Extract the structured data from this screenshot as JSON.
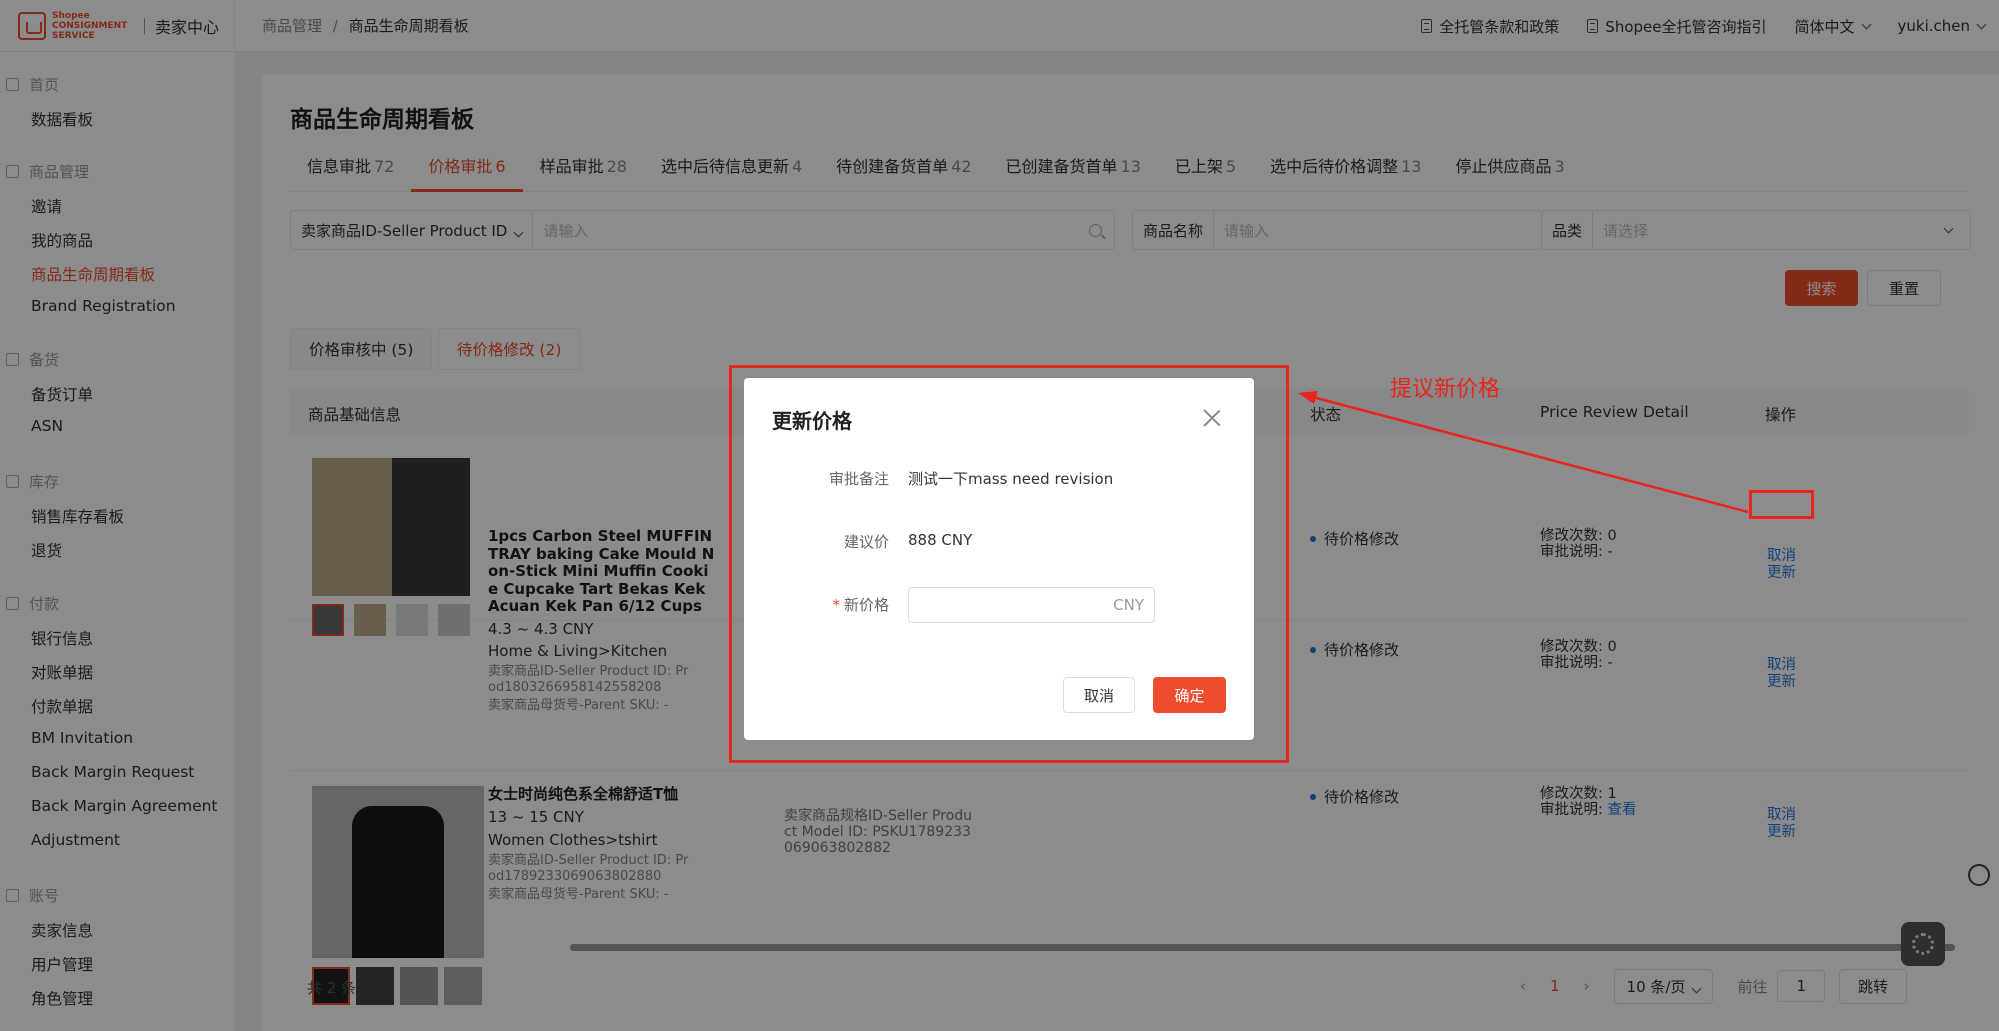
{
  "header": {
    "logo_text": "Shopee CONSIGNMENT SERVICE",
    "center_title": "卖家中心",
    "breadcrumb_parent": "商品管理",
    "breadcrumb_sep": "/",
    "breadcrumb_current": "商品生命周期看板",
    "links": [
      "全托管条款和政策",
      "Shopee全托管咨询指引"
    ],
    "language": "简体中文",
    "user": "yuki.chen"
  },
  "sidebar": {
    "groups": [
      {
        "label": "首页",
        "items": [
          "数据看板"
        ]
      },
      {
        "label": "商品管理",
        "items": [
          "邀请",
          "我的商品",
          "商品生命周期看板",
          "Brand Registration"
        ]
      },
      {
        "label": "备货",
        "items": [
          "备货订单",
          "ASN"
        ]
      },
      {
        "label": "库存",
        "items": [
          "销售库存看板",
          "退货"
        ]
      },
      {
        "label": "付款",
        "items": [
          "银行信息",
          "对账单据",
          "付款单据",
          "BM Invitation",
          "Back Margin Request",
          "Back Margin Agreement",
          "Adjustment"
        ]
      },
      {
        "label": "账号",
        "items": [
          "卖家信息",
          "用户管理",
          "角色管理"
        ]
      }
    ],
    "active_item": "商品生命周期看板"
  },
  "page": {
    "title": "商品生命周期看板",
    "tabs": [
      {
        "label": "信息审批",
        "count": "72"
      },
      {
        "label": "价格审批",
        "count": "6"
      },
      {
        "label": "样品审批",
        "count": "28"
      },
      {
        "label": "选中后待信息更新",
        "count": "4"
      },
      {
        "label": "待创建备货首单",
        "count": "42"
      },
      {
        "label": "已创建备货首单",
        "count": "13"
      },
      {
        "label": "已上架",
        "count": "5"
      },
      {
        "label": "选中后待价格调整",
        "count": "13"
      },
      {
        "label": "停止供应商品",
        "count": "3"
      }
    ],
    "active_tab": "价格审批"
  },
  "filters": {
    "id_select": "卖家商品ID-Seller Product ID",
    "id_placeholder": "请输入",
    "name_label": "商品名称",
    "name_placeholder": "请输入",
    "category_label": "品类",
    "category_placeholder": "请选择",
    "search_button": "搜索",
    "reset_button": "重置"
  },
  "subtabs": [
    {
      "label": "价格审核中 (5)"
    },
    {
      "label": "待价格修改 (2)"
    }
  ],
  "table": {
    "headers": {
      "product": "商品基础信息",
      "status": "状态",
      "review": "Price Review Detail",
      "action": "操作"
    },
    "rows": [
      {
        "title": "1pcs Carbon Steel MUFFIN TRAY baking Cake Mould Non-Stick Mini Muffin Cookie Cupcake Tart Bekas Kek Acuan Kek Pan 6/12 Cups",
        "title_lines": [
          "1pcs Carbon Steel MUFFIN",
          "TRAY baking Cake Mould N",
          "on-Stick Mini Muffin Cooki",
          "e Cupcake Tart Bekas Kek",
          "Acuan Kek Pan 6/12 Cups"
        ],
        "price": "4.3 ~ 4.3 CNY",
        "category": "Home & Living>Kitchen",
        "product_id_lines": [
          "卖家商品ID-Seller Product ID: Pr",
          "od1803266958142558208"
        ],
        "parent_sku": "卖家商品母货号-Parent SKU: -",
        "status": "待价格修改",
        "edit_count": "修改次数: 0",
        "review_note": "审批说明: -",
        "cancel": "取消",
        "update": "更新"
      },
      {
        "status": "待价格修改",
        "edit_count": "修改次数: 0",
        "review_note": "审批说明: -",
        "cancel": "取消",
        "update": "更新"
      },
      {
        "title_lines": [
          "女士时尚纯色系全棉舒适T恤"
        ],
        "price": "13 ~ 15 CNY",
        "category": "Women Clothes>tshirt",
        "product_id_lines": [
          "卖家商品ID-Seller Product ID: Pr",
          "od1789233069063802880"
        ],
        "parent_sku": "卖家商品母货号-Parent SKU: -",
        "model_id_lines": [
          "卖家商品规格ID-Seller Produ",
          "ct Model ID: PSKU1789233",
          "069063802882"
        ],
        "status": "待价格修改",
        "edit_count": "修改次数: 1",
        "review_note": "审批说明:",
        "view_link": "查看",
        "cancel": "取消",
        "update": "更新"
      }
    ]
  },
  "footer": {
    "total": "共 2 条",
    "current_page": "1",
    "page_size": "10 条/页",
    "goto_label": "前往",
    "goto_value": "1",
    "jump_button": "跳转"
  },
  "modal": {
    "title": "更新价格",
    "note_label": "审批备注",
    "note_value": "测试一下mass need revision",
    "suggest_label": "建议价",
    "suggest_value": "888 CNY",
    "required_mark": "*",
    "new_price_label": "新价格",
    "new_price_unit": "CNY",
    "cancel_button": "取消",
    "confirm_button": "确定"
  },
  "annotation": {
    "text": "提议新价格",
    "color": "#e8251c"
  },
  "colors": {
    "accent": "#ee4d2d",
    "link": "#2673dd"
  }
}
